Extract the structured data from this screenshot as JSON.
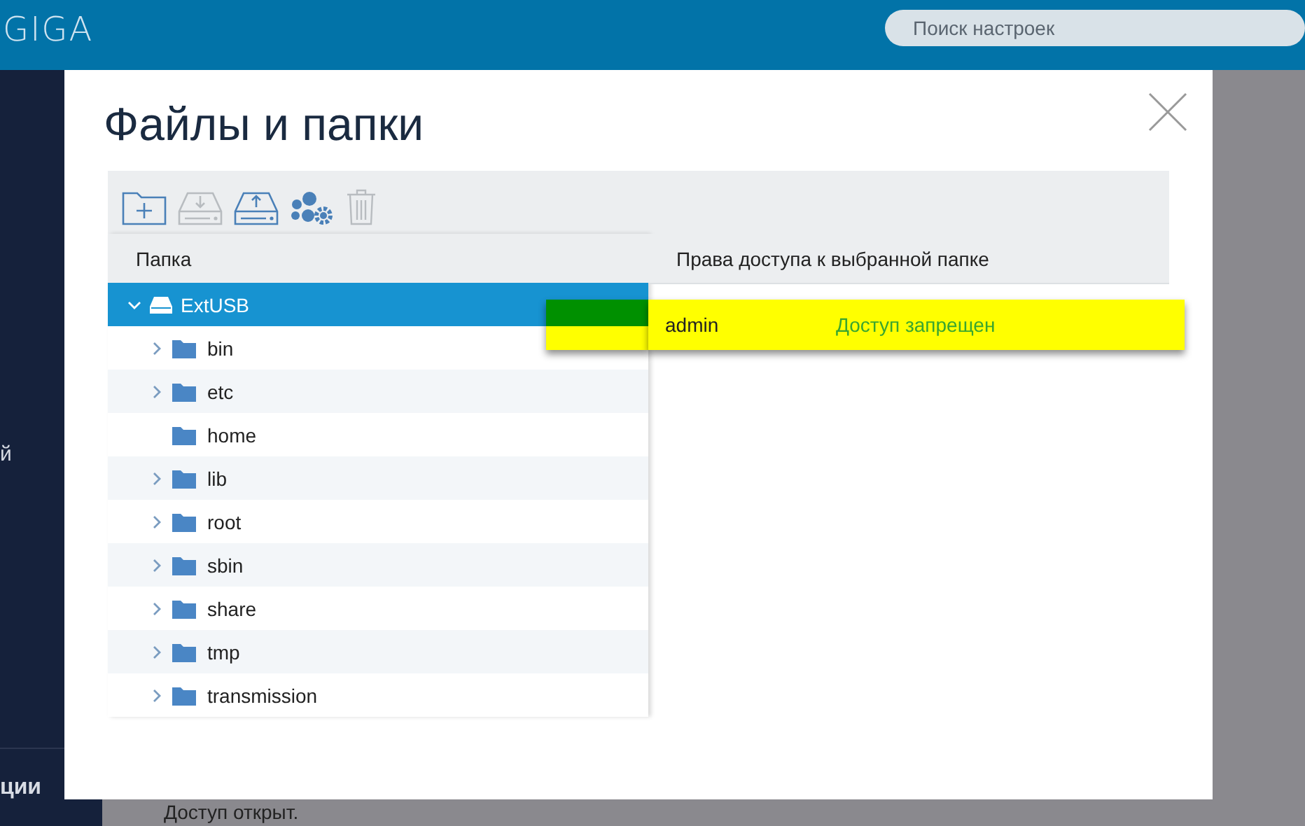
{
  "header": {
    "logo": "GIGA",
    "search": {
      "placeholder": "Поиск настроек"
    }
  },
  "sidebar": {
    "items": [
      "й",
      "ции"
    ]
  },
  "background": {
    "status_text": "Доступ открыт."
  },
  "dialog": {
    "title": "Файлы и папки",
    "toolbar": [
      {
        "kind": "new-folder",
        "disabled": false
      },
      {
        "kind": "download",
        "disabled": true
      },
      {
        "kind": "upload",
        "disabled": false
      },
      {
        "kind": "users",
        "disabled": false
      },
      {
        "kind": "delete",
        "disabled": true
      }
    ],
    "tree": {
      "header": "Папка",
      "items": [
        {
          "label": "ExtUSB",
          "kind": "drive",
          "selected": true,
          "expanded": true,
          "children": [
            {
              "label": "bin",
              "kind": "folder",
              "selected": false,
              "expandable": true
            },
            {
              "label": "etc",
              "kind": "folder",
              "selected": false,
              "expandable": true
            },
            {
              "label": "home",
              "kind": "folder",
              "selected": false,
              "expandable": false
            },
            {
              "label": "lib",
              "kind": "folder",
              "selected": false,
              "expandable": true
            },
            {
              "label": "root",
              "kind": "folder",
              "selected": false,
              "expandable": true
            },
            {
              "label": "sbin",
              "kind": "folder",
              "selected": false,
              "expandable": true
            },
            {
              "label": "share",
              "kind": "folder",
              "selected": false,
              "expandable": true
            },
            {
              "label": "tmp",
              "kind": "folder",
              "selected": false,
              "expandable": true
            },
            {
              "label": "transmission",
              "kind": "folder",
              "selected": false,
              "expandable": true
            }
          ]
        }
      ]
    },
    "permissions": {
      "header": "Права доступа к выбранной папке",
      "rows": [
        {
          "user": "admin",
          "access": "Доступ запрещен",
          "highlighted": true
        }
      ]
    }
  }
}
